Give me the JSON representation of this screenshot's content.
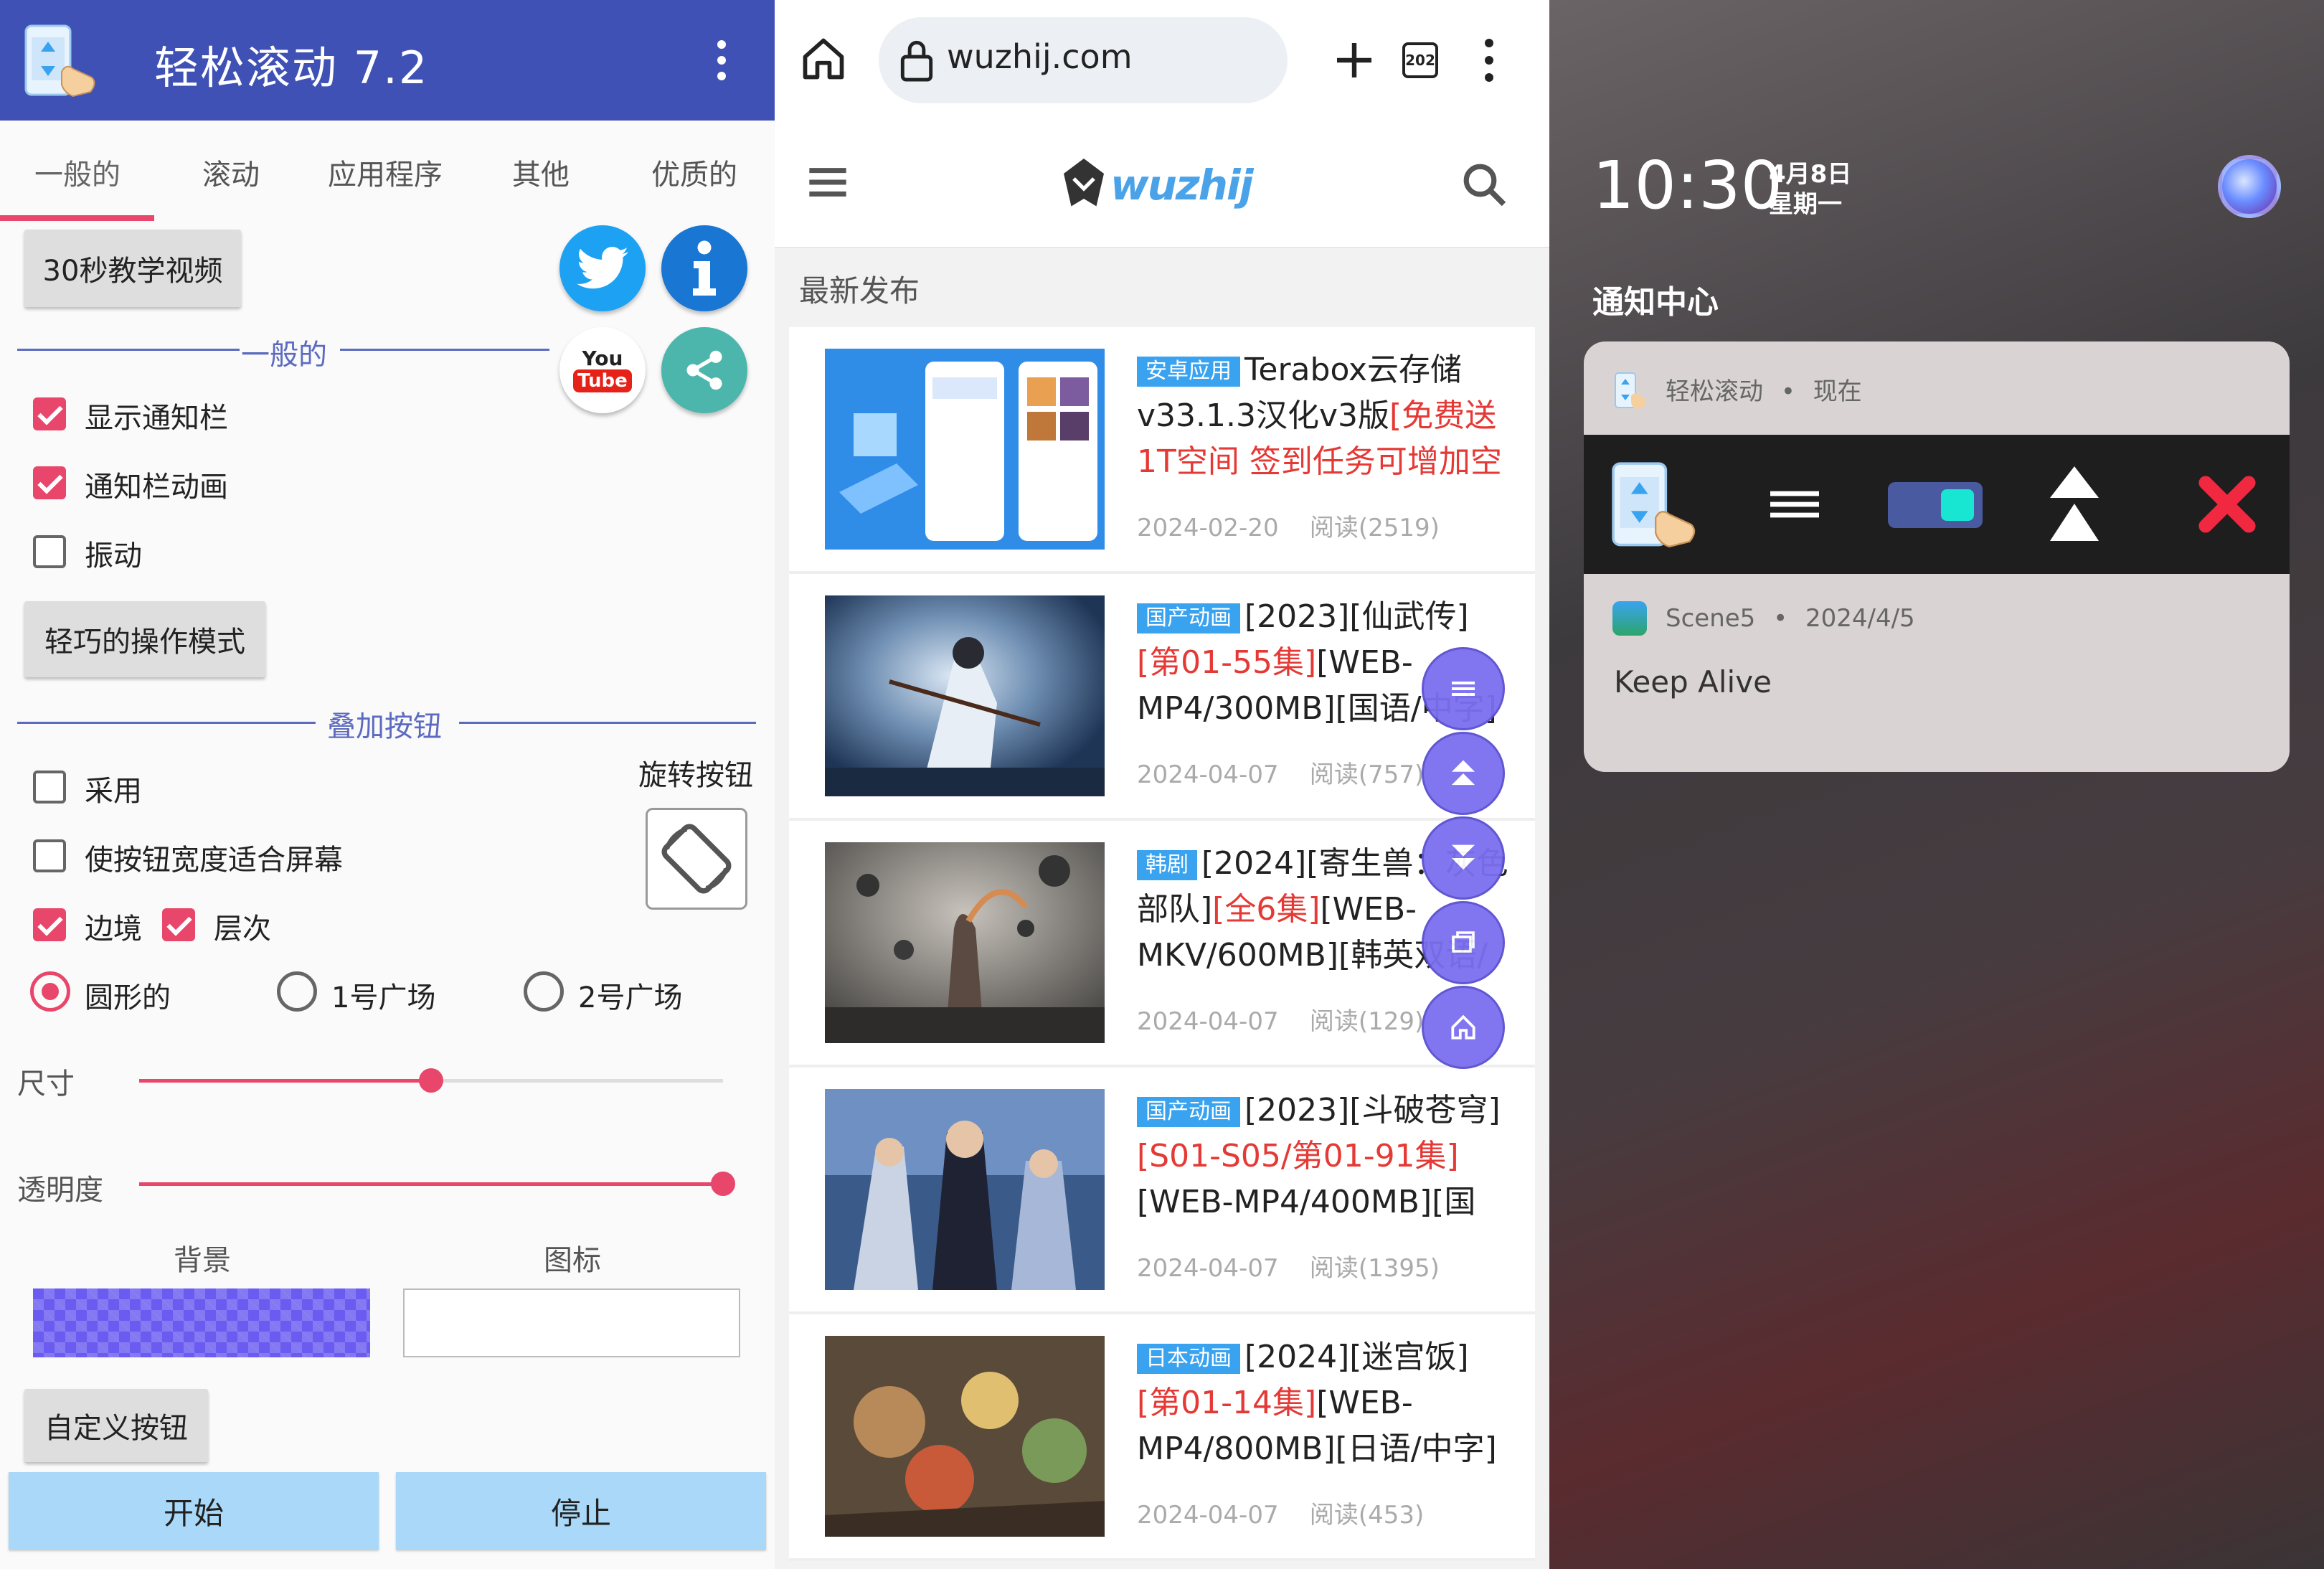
{
  "left_app": {
    "title": "轻松滚动 7.2",
    "tabs": [
      "一般的",
      "滚动",
      "应用程序",
      "其他",
      "优质的"
    ],
    "tutorial_button": "30秒教学视频",
    "section_general": "一般的",
    "checkbox_show_notification": {
      "label": "显示通知栏",
      "checked": true
    },
    "checkbox_notification_anim": {
      "label": "通知栏动画",
      "checked": true
    },
    "checkbox_vibrate": {
      "label": "振动",
      "checked": false
    },
    "smart_mode_button": "轻巧的操作模式",
    "section_overlay": "叠加按钮",
    "rotate_label": "旋转按钮",
    "checkbox_adopt": {
      "label": "采用",
      "checked": false
    },
    "checkbox_fit_width": {
      "label": "使按钮宽度适合屏幕",
      "checked": false
    },
    "checkbox_border": {
      "label": "边境",
      "checked": true
    },
    "checkbox_layer": {
      "label": "层次",
      "checked": true
    },
    "radio_round": {
      "label": "圆形的",
      "selected": true
    },
    "radio_square1": {
      "label": "1号广场",
      "selected": false
    },
    "radio_square2": {
      "label": "2号广场",
      "selected": false
    },
    "size_label": "尺寸",
    "size_value": 0.5,
    "opacity_label": "透明度",
    "opacity_value": 1.0,
    "background_label": "背景",
    "icon_label": "图标",
    "background_color": "#6a5cf0",
    "custom_button": "自定义按钮",
    "start_button": "开始",
    "stop_button": "停止",
    "youtube_you": "You",
    "youtube_tube": "Tube",
    "colors": {
      "appbar": "#3f51b5",
      "accent": "#e8466a",
      "twitter": "#1da1f2",
      "share": "#4db6ac"
    }
  },
  "browser": {
    "url": "wuzhij.com",
    "tab_count": "202",
    "site_logo": "wuzhij",
    "section_title": "最新发布",
    "posts": [
      {
        "tag": "安卓应用",
        "title_parts": [
          {
            "t": "Terabox云存储v33.1.3汉化v3版",
            "red": false
          },
          {
            "t": "[免费送1T空间 签到任务可增加空",
            "red": true
          }
        ],
        "date": "2024-02-20",
        "reads": "阅读(2519)"
      },
      {
        "tag": "国产动画",
        "title_parts": [
          {
            "t": "[2023][仙武传]",
            "red": false
          },
          {
            "t": "[第01-55集]",
            "red": true
          },
          {
            "t": "[WEB-MP4/300MB][国语/中字]",
            "red": false
          }
        ],
        "date": "2024-04-07",
        "reads": "阅读(757)"
      },
      {
        "tag": "韩剧",
        "title_parts": [
          {
            "t": "[2024][寄生兽：灰色部队]",
            "red": false
          },
          {
            "t": "[全6集]",
            "red": true
          },
          {
            "t": "[WEB-MKV/600MB][韩英双语/",
            "red": false
          }
        ],
        "date": "2024-04-07",
        "reads": "阅读(129)"
      },
      {
        "tag": "国产动画",
        "title_parts": [
          {
            "t": "[2023][斗破苍穹]",
            "red": false
          },
          {
            "t": "[S01-S05/第01-91集]",
            "red": true
          },
          {
            "t": "[WEB-MP4/400MB][国",
            "red": false
          }
        ],
        "date": "2024-04-07",
        "reads": "阅读(1395)"
      },
      {
        "tag": "日本动画",
        "title_parts": [
          {
            "t": "[2024][迷宫饭]",
            "red": false
          },
          {
            "t": "[第01-14集]",
            "red": true
          },
          {
            "t": "[WEB-MP4/800MB][日语/中字]",
            "red": false
          }
        ],
        "date": "2024-04-07",
        "reads": "阅读(453)"
      }
    ],
    "colors": {
      "tag": "#3aa3f0",
      "fab": "#7b6ff0",
      "red": "#e53935"
    }
  },
  "notification": {
    "time": "10:30",
    "date_line1": "4月8日",
    "date_line2": "星期一",
    "center_title": "通知中心",
    "app_name": "轻松滚动",
    "app_time": "现在",
    "separator": "•",
    "second_app": "Scene5",
    "second_date": "2024/4/5",
    "second_text": "Keep Alive"
  }
}
